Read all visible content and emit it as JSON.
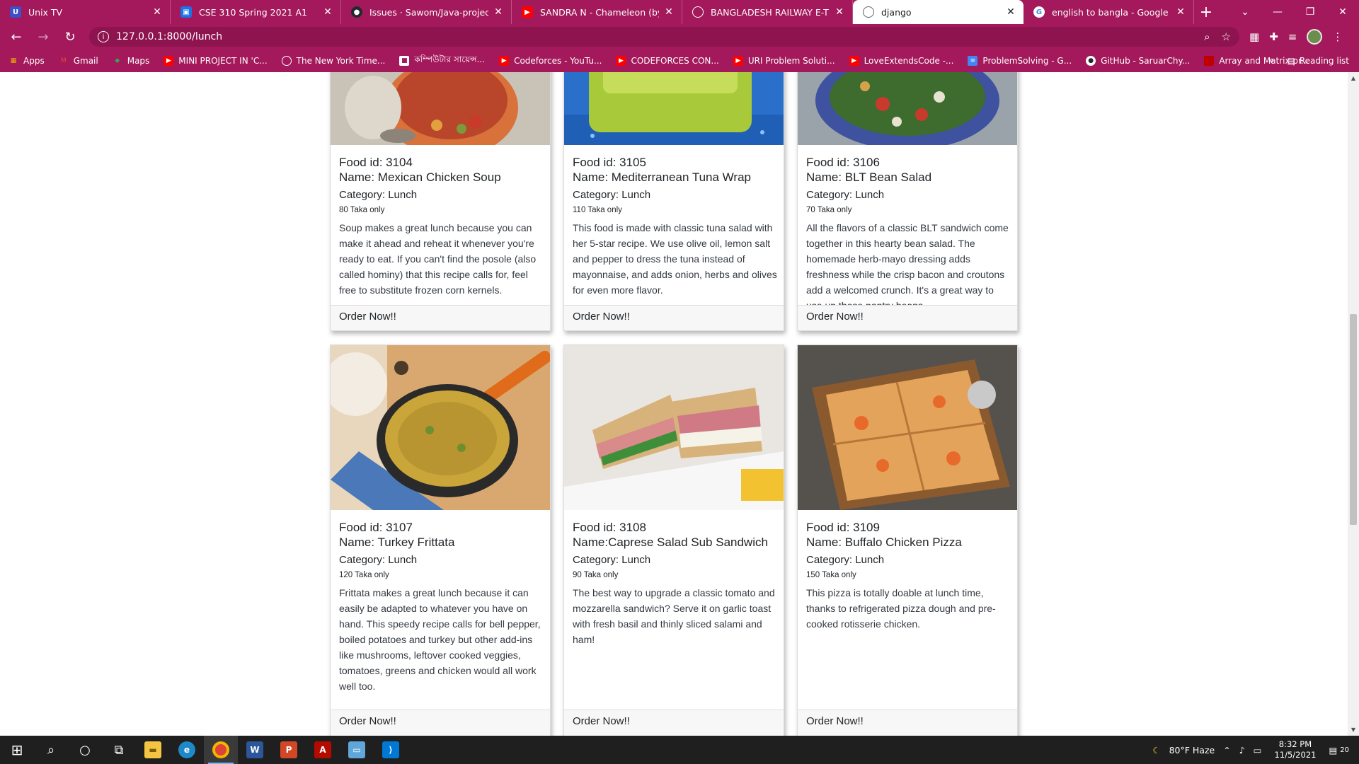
{
  "browser": {
    "tabs": [
      {
        "title": "Unix TV",
        "favicon": "U",
        "color": "#3b50c9",
        "active": false
      },
      {
        "title": "CSE 310 Spring 2021 A1",
        "favicon": "▣",
        "color": "#1a73e8",
        "active": false
      },
      {
        "title": "Issues · Sawom/Java-project",
        "favicon": "●",
        "color": "#24292e",
        "active": false
      },
      {
        "title": "SANDRA N - Chameleon (by Mo",
        "favicon": "▶",
        "color": "#ff0000",
        "active": false
      },
      {
        "title": "BANGLADESH RAILWAY E-TICKE",
        "favicon": "◍",
        "color": "#5f6368",
        "active": false
      },
      {
        "title": "django",
        "favicon": "◍",
        "color": "#5f6368",
        "active": true
      },
      {
        "title": "english to bangla - Google Sear",
        "favicon": "G",
        "color": "#4285f4",
        "active": false
      }
    ],
    "new_tab_label": "+",
    "address": "127.0.0.1:8000/lunch",
    "bookmarks": [
      {
        "label": "Apps",
        "icon": "apps-grid-icon",
        "color": "#f4b400"
      },
      {
        "label": "Gmail",
        "icon": "gmail-icon",
        "color": "#ea4335"
      },
      {
        "label": "Maps",
        "icon": "maps-icon",
        "color": "#34a853"
      },
      {
        "label": "MINI PROJECT IN 'C...",
        "icon": "youtube-icon",
        "color": "#ff0000"
      },
      {
        "label": "The New York Time...",
        "icon": "globe-icon",
        "color": "#ffffff"
      },
      {
        "label": "কম্পিউটার সায়েন্স...",
        "icon": "bookmark-icon",
        "color": "#ffffff"
      },
      {
        "label": "Codeforces - YouTu...",
        "icon": "youtube-icon",
        "color": "#ff0000"
      },
      {
        "label": "CODEFORCES CON...",
        "icon": "youtube-icon",
        "color": "#ff0000"
      },
      {
        "label": "URI Problem Soluti...",
        "icon": "youtube-icon",
        "color": "#ff0000"
      },
      {
        "label": "LoveExtendsCode -...",
        "icon": "youtube-icon",
        "color": "#ff0000"
      },
      {
        "label": "ProblemSolving - G...",
        "icon": "docs-icon",
        "color": "#4285f4"
      },
      {
        "label": "GitHub - SaruarChy...",
        "icon": "github-icon",
        "color": "#ffffff"
      },
      {
        "label": "Array and Matrix pr...",
        "icon": "folder-icon",
        "color": "#c00000"
      }
    ],
    "reading_list": "Reading list"
  },
  "foods": [
    {
      "id_text": "Food id: 3104",
      "name_text": "Name: Mexican Chicken Soup",
      "category_text": "Category: Lunch",
      "price_text": "80 Taka only",
      "description": "Soup makes a great lunch because you can make it ahead and reheat it whenever you're ready to eat. If you can't find the posole (also called hominy) that this recipe calls for, feel free to substitute frozen corn kernels.",
      "order_label": "Order Now!!"
    },
    {
      "id_text": "Food id: 3105",
      "name_text": "Name: Mediterranean Tuna Wrap",
      "category_text": "Category: Lunch",
      "price_text": "110 Taka only",
      "description": "This food is made with classic tuna salad with her 5-star recipe. We use olive oil, lemon salt and pepper to dress the tuna instead of mayonnaise, and adds onion, herbs and olives for even more flavor.",
      "order_label": "Order Now!!"
    },
    {
      "id_text": "Food id: 3106",
      "name_text": "Name: BLT Bean Salad",
      "category_text": "Category: Lunch",
      "price_text": "70 Taka only",
      "description": "All the flavors of a classic BLT sandwich come together in this hearty bean salad. The homemade herb-mayo dressing adds freshness while the crisp bacon and croutons add a welcomed crunch. It's a great way to use up those pantry beans.",
      "order_label": "Order Now!!"
    },
    {
      "id_text": "Food id: 3107",
      "name_text": "Name: Turkey Frittata",
      "category_text": "Category: Lunch",
      "price_text": "120 Taka only",
      "description": "Frittata makes a great lunch because it can easily be adapted to whatever you have on hand. This speedy recipe calls for bell pepper, boiled potatoes and turkey but other add-ins like mushrooms, leftover cooked veggies, tomatoes, greens and chicken would all work well too.",
      "order_label": "Order Now!!"
    },
    {
      "id_text": "Food id: 3108",
      "name_text": "Name:Caprese Salad Sub Sandwich",
      "category_text": "Category: Lunch",
      "price_text": "90 Taka only",
      "description": "The best way to upgrade a classic tomato and mozzarella sandwich? Serve it on garlic toast with fresh basil and thinly sliced salami and ham!",
      "order_label": "Order Now!!"
    },
    {
      "id_text": "Food id: 3109",
      "name_text": "Name: Buffalo Chicken Pizza",
      "category_text": "Category: Lunch",
      "price_text": "150 Taka only",
      "description": "This pizza is totally doable at lunch time, thanks to refrigerated pizza dough and pre-cooked rotisserie chicken.",
      "order_label": "Order Now!!"
    }
  ],
  "taskbar": {
    "weather": "80°F  Haze",
    "time": "8:32 PM",
    "date": "11/5/2021",
    "notifications": "20"
  }
}
